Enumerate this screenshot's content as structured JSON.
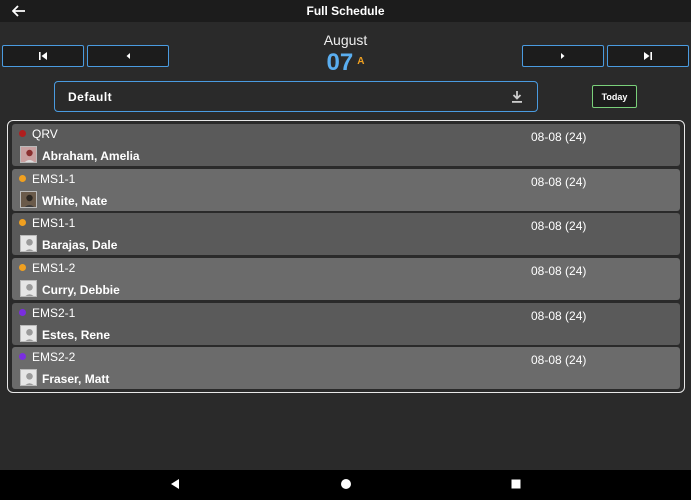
{
  "header": {
    "title": "Full Schedule",
    "back_icon": "arrow-left-icon"
  },
  "date": {
    "month": "August",
    "day": "07",
    "shift": "A"
  },
  "nav": {
    "first_icon": "skip-first-icon",
    "prev_icon": "prev-icon",
    "next_icon": "next-icon",
    "last_icon": "skip-last-icon"
  },
  "filter": {
    "selected": "Default",
    "download_icon": "download-icon"
  },
  "today_button": {
    "label": "Today",
    "color": "#7ad07a"
  },
  "accent_color": "#4a9be0",
  "rows": [
    {
      "unit": "QRV",
      "name": "Abraham, Amelia",
      "date": "08-08 (24)",
      "dot_color": "#b01e1e",
      "avatar": "photo"
    },
    {
      "unit": "EMS1-1",
      "name": "White, Nate",
      "date": "08-08 (24)",
      "dot_color": "#f0a020",
      "avatar": "photo"
    },
    {
      "unit": "EMS1-1",
      "name": "Barajas, Dale",
      "date": "08-08 (24)",
      "dot_color": "#f0a020",
      "avatar": "placeholder"
    },
    {
      "unit": "EMS1-2",
      "name": "Curry, Debbie",
      "date": "08-08 (24)",
      "dot_color": "#f0a020",
      "avatar": "placeholder"
    },
    {
      "unit": "EMS2-1",
      "name": "Estes, Rene",
      "date": "08-08 (24)",
      "dot_color": "#7a2ee0",
      "avatar": "placeholder"
    },
    {
      "unit": "EMS2-2",
      "name": "Fraser, Matt",
      "date": "08-08 (24)",
      "dot_color": "#7a2ee0",
      "avatar": "placeholder"
    }
  ],
  "system_nav": {
    "back_icon": "triangle-back-icon",
    "home_icon": "circle-home-icon",
    "recents_icon": "square-recents-icon"
  }
}
